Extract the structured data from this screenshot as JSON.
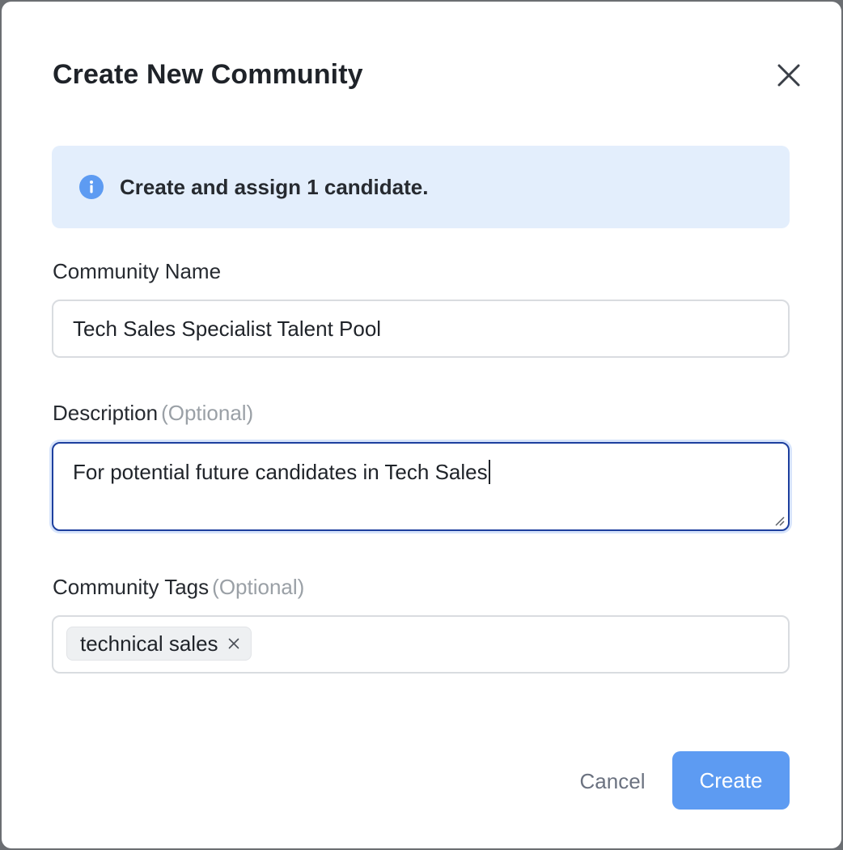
{
  "dialog": {
    "title": "Create New Community"
  },
  "info": {
    "message": "Create and assign 1 candidate.",
    "icon": "info-icon",
    "color": "#5d9bf2"
  },
  "form": {
    "name": {
      "label": "Community Name",
      "value": "Tech Sales Specialist Talent Pool"
    },
    "description": {
      "label": "Description",
      "optional_label": "(Optional)",
      "value": "For potential future candidates in Tech Sales"
    },
    "tags": {
      "label": "Community Tags",
      "optional_label": "(Optional)",
      "items": [
        {
          "label": "technical sales"
        }
      ]
    }
  },
  "actions": {
    "cancel_label": "Cancel",
    "create_label": "Create",
    "create_color": "#5d9bf2"
  }
}
